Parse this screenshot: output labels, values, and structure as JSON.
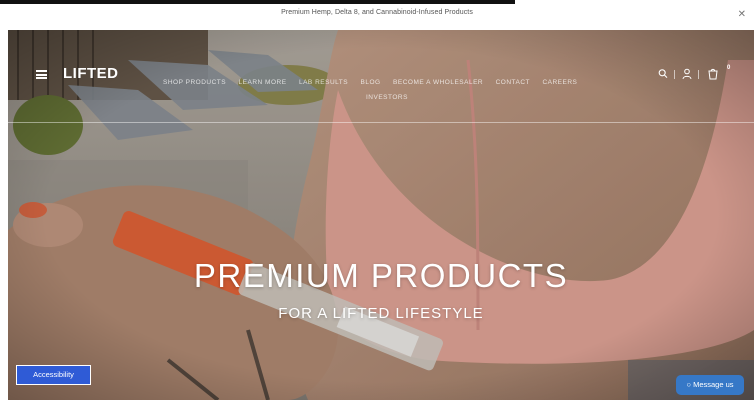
{
  "announcement": {
    "text": "Premium Hemp, Delta 8, and Cannabinoid-Infused Products",
    "close_icon": "close-icon"
  },
  "header": {
    "logo": "LIFTED",
    "nav": [
      {
        "label": "SHOP PRODUCTS"
      },
      {
        "label": "LEARN MORE"
      },
      {
        "label": "LAB RESULTS"
      },
      {
        "label": "BLOG"
      },
      {
        "label": "BECOME A WHOLESALER"
      },
      {
        "label": "CONTACT"
      },
      {
        "label": "CAREERS"
      }
    ],
    "investors": "INVESTORS",
    "cart_count": "0",
    "icons": [
      "menu-icon",
      "search-icon",
      "account-icon",
      "cart-icon"
    ]
  },
  "hero": {
    "headline": "PREMIUM PRODUCTS",
    "subline": "FOR A LIFTED LIFESTYLE"
  },
  "widgets": {
    "accessibility": "Accessibility",
    "message": "Message us"
  },
  "colors": {
    "accessibility_bg": "#2f5bd6",
    "message_bg": "#3678c7",
    "header_text": "#ffffff"
  }
}
